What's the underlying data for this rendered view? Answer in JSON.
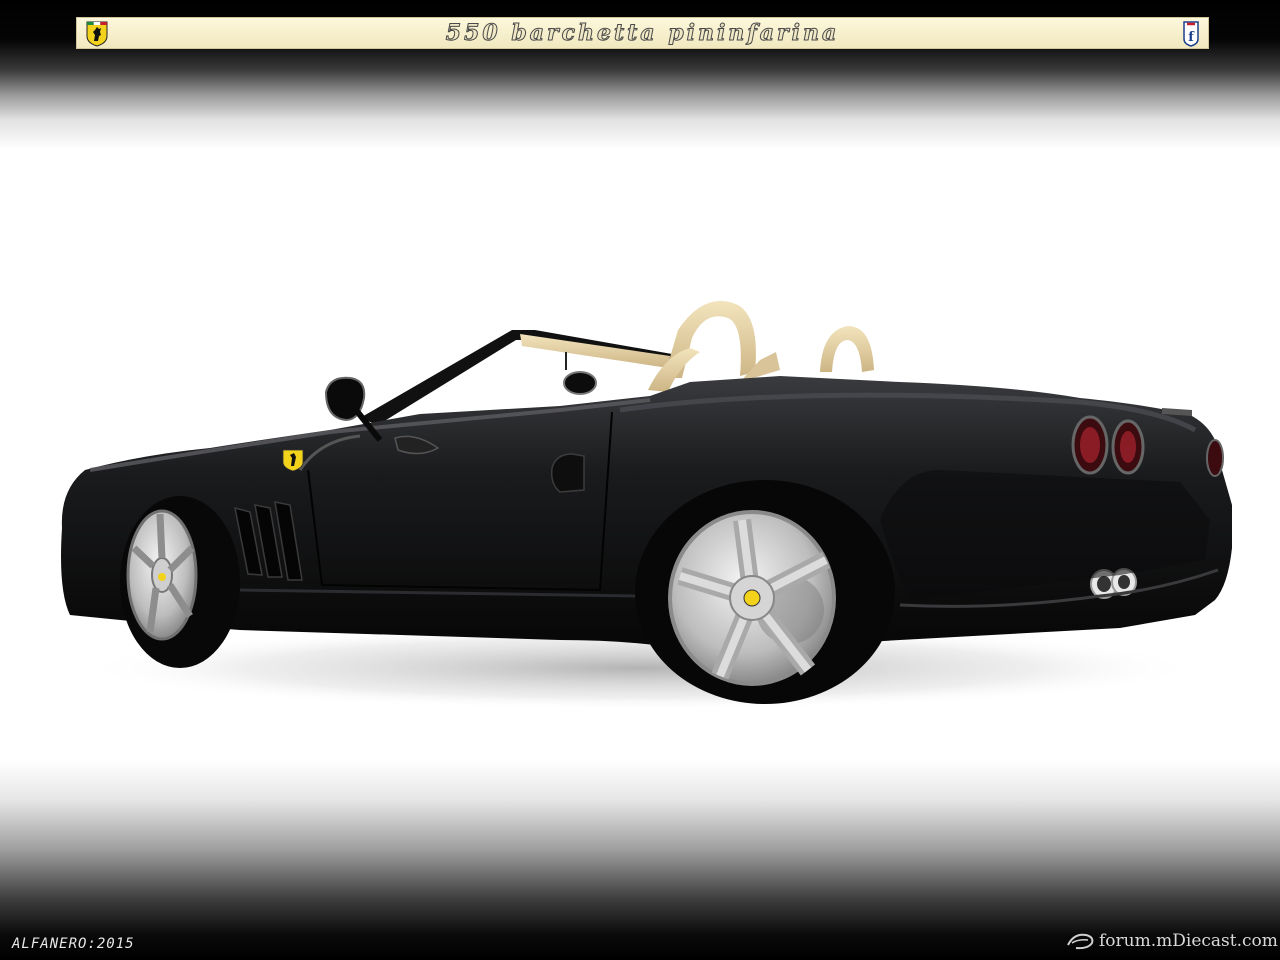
{
  "title": "550 barchetta pininfarina",
  "signature": "ALFANERO:2015",
  "watermark": "forum.mDiecast.com",
  "icons": {
    "left_logo": "ferrari-shield-icon",
    "right_logo": "pininfarina-f-icon",
    "watermark_logo": "mdiecast-swoosh-icon"
  },
  "colors": {
    "car_body": "#0d0d0e",
    "interior": "#e6d3a8",
    "title_bar": "#f6efcf",
    "ferrari_yellow": "#f2d21a"
  }
}
